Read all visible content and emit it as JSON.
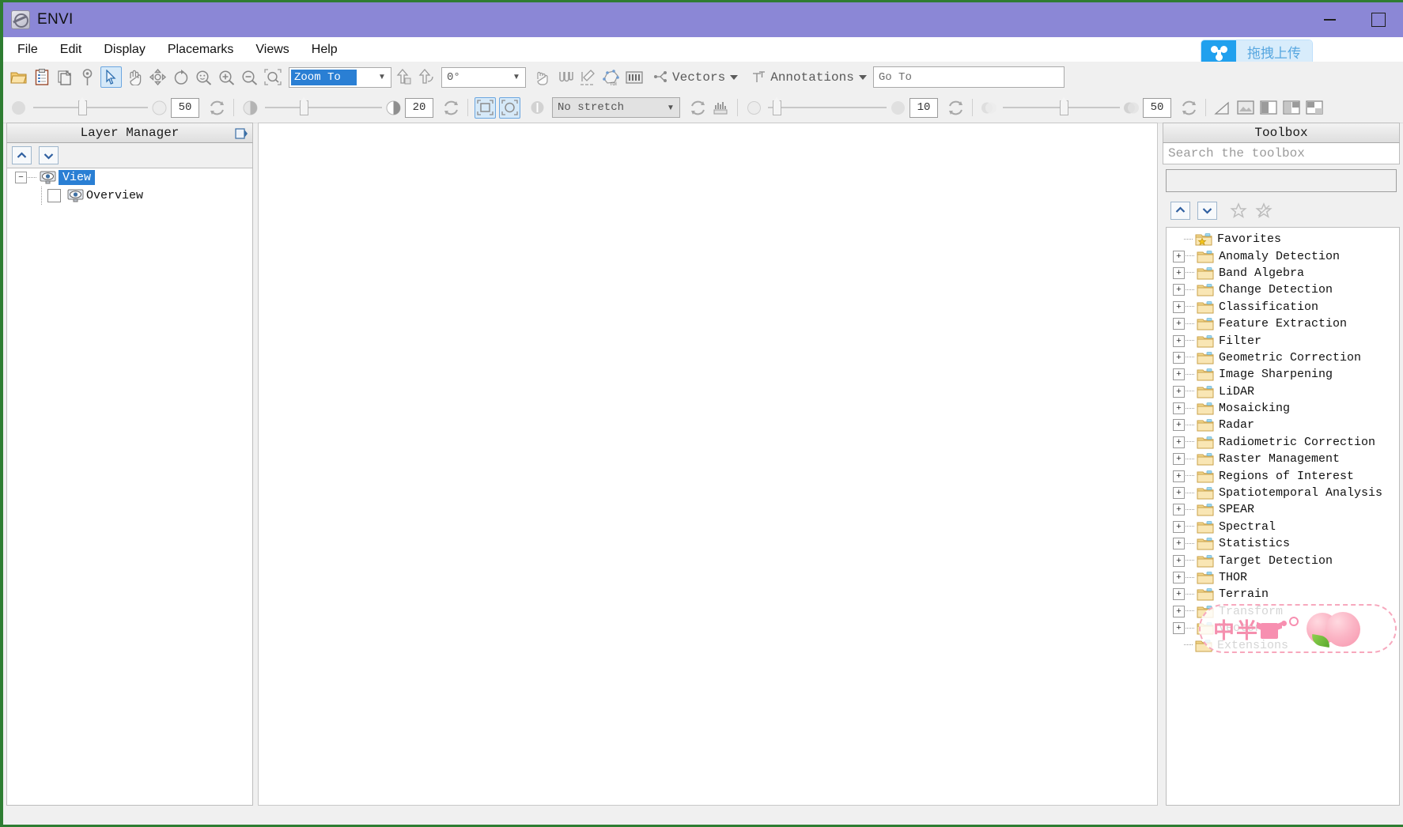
{
  "window": {
    "title": "ENVI",
    "app_icon": "envi-globe-icon",
    "minimize_label": "minimize",
    "maximize_label": "maximize"
  },
  "menu": {
    "items": [
      {
        "label": "File"
      },
      {
        "label": "Edit"
      },
      {
        "label": "Display"
      },
      {
        "label": "Placemarks"
      },
      {
        "label": "Views"
      },
      {
        "label": "Help"
      }
    ],
    "upload_button": {
      "label": "拖拽上传",
      "icon": "cloud-upload-icon",
      "icon_bg": "#20a0ee",
      "label_bg": "#d8ecfb",
      "label_color": "#58a7e0"
    }
  },
  "toolbar_main": {
    "buttons": [
      {
        "name": "open-file-icon",
        "title": "Open"
      },
      {
        "name": "clipboard-icon",
        "title": "Open Recent"
      },
      {
        "name": "save-layers-icon",
        "title": "Save"
      },
      {
        "name": "placemark-pin-icon",
        "title": "Placemark"
      },
      {
        "name": "select-arrow-icon",
        "title": "Select",
        "selected": true
      },
      {
        "name": "pan-hand-icon",
        "title": "Pan"
      },
      {
        "name": "fly-move-icon",
        "title": "Fly"
      },
      {
        "name": "rotate-icon",
        "title": "Rotate"
      },
      {
        "name": "zoom-full-icon",
        "title": "Zoom to Full Extent"
      },
      {
        "name": "zoom-in-icon",
        "title": "Zoom In"
      },
      {
        "name": "zoom-out-icon",
        "title": "Zoom Out"
      },
      {
        "name": "zoom-window-icon",
        "title": "Zoom to Window"
      }
    ],
    "zoom_combo": {
      "value": "Zoom To",
      "selected": true
    },
    "north_buttons": [
      {
        "name": "north-up-icon",
        "title": "North Up"
      },
      {
        "name": "rotate-north-icon",
        "title": "Rotate to North"
      }
    ],
    "angle_combo": {
      "value": "0°"
    },
    "right_buttons": [
      {
        "name": "crosshair-cursor-icon",
        "title": "Cursor Value"
      },
      {
        "name": "spectral-profile-icon",
        "title": "Spectral Profile"
      },
      {
        "name": "transect-icon",
        "title": "Transect"
      },
      {
        "name": "roi-tool-icon",
        "title": "Region of Interest"
      },
      {
        "name": "band-threshold-icon",
        "title": "Band Threshold"
      }
    ],
    "vectors_menu": {
      "label": "Vectors",
      "icon": "vectors-icon"
    },
    "annotations_menu": {
      "label": "Annotations",
      "icon": "annotations-text-icon"
    },
    "goto_combo": {
      "value": "Go To"
    }
  },
  "toolbar_secondary": {
    "brightness": {
      "icon": "brightness-icon",
      "value": "50",
      "reset_icon": "reset-icon",
      "slider_pct": 42
    },
    "contrast": {
      "icon": "contrast-icon",
      "value": "20",
      "reset_icon": "reset-icon",
      "slider_pct": 30
    },
    "portal_buttons": [
      {
        "name": "portal-rect-icon",
        "title": "Portal",
        "selected": true
      },
      {
        "name": "portal-blend-icon",
        "title": "Blend Portal"
      }
    ],
    "stretch_refresh": {
      "name": "stretch-refresh-icon"
    },
    "stretch_combo": {
      "value": "No stretch"
    },
    "stretch_reset": {
      "name": "reset-icon"
    },
    "histogram_button": {
      "name": "histogram-icon"
    },
    "sharpen": {
      "icon": "sharpen-icon",
      "value": "10",
      "reset_icon": "reset-icon",
      "slider_pct": 5
    },
    "transparency": {
      "icon": "transparency-icon",
      "value": "50",
      "reset_icon": "reset-icon",
      "slider_pct": 52
    },
    "end_buttons": [
      {
        "name": "measure-icon",
        "title": "Measure"
      },
      {
        "name": "image-view-icon",
        "title": "Image View"
      },
      {
        "name": "two-panel-view-icon",
        "title": "Two Panel View"
      },
      {
        "name": "three-panel-view-icon",
        "title": "Three Panel View"
      },
      {
        "name": "four-panel-view-icon",
        "title": "Four Panel View"
      }
    ]
  },
  "layer_manager": {
    "title": "Layer Manager",
    "pin_icon": "pin-icon",
    "up_button": "move-up-icon",
    "down_button": "move-down-icon",
    "tree": [
      {
        "label": "View",
        "icon": "view-eye-icon",
        "expander": "−",
        "selected": true,
        "children": [
          {
            "label": "Overview",
            "icon": "view-eye-icon",
            "checkbox": true,
            "checked": false
          }
        ]
      }
    ]
  },
  "toolbox": {
    "title": "Toolbox",
    "search": {
      "placeholder": "Search the toolbox",
      "value": ""
    },
    "filter_box_value": "",
    "up_button": "move-up-icon",
    "down_button": "move-down-icon",
    "add_favorite_button": "star-add-icon",
    "remove_favorite_button": "star-remove-icon",
    "items": [
      {
        "label": "Favorites",
        "icon": "favorites-folder-icon",
        "expandable": false
      },
      {
        "label": "Anomaly Detection",
        "icon": "folder-icon",
        "expandable": true
      },
      {
        "label": "Band Algebra",
        "icon": "folder-icon",
        "expandable": true
      },
      {
        "label": "Change Detection",
        "icon": "folder-icon",
        "expandable": true
      },
      {
        "label": "Classification",
        "icon": "folder-icon",
        "expandable": true
      },
      {
        "label": "Feature Extraction",
        "icon": "folder-icon",
        "expandable": true
      },
      {
        "label": "Filter",
        "icon": "folder-icon",
        "expandable": true
      },
      {
        "label": "Geometric Correction",
        "icon": "folder-icon",
        "expandable": true
      },
      {
        "label": "Image Sharpening",
        "icon": "folder-icon",
        "expandable": true
      },
      {
        "label": "LiDAR",
        "icon": "folder-icon",
        "expandable": true
      },
      {
        "label": "Mosaicking",
        "icon": "folder-icon",
        "expandable": true
      },
      {
        "label": "Radar",
        "icon": "folder-icon",
        "expandable": true
      },
      {
        "label": "Radiometric Correction",
        "icon": "folder-icon",
        "expandable": true
      },
      {
        "label": "Raster Management",
        "icon": "folder-icon",
        "expandable": true
      },
      {
        "label": "Regions of Interest",
        "icon": "folder-icon",
        "expandable": true
      },
      {
        "label": "Spatiotemporal Analysis",
        "icon": "folder-icon",
        "expandable": true
      },
      {
        "label": "SPEAR",
        "icon": "folder-icon",
        "expandable": true
      },
      {
        "label": "Spectral",
        "icon": "folder-icon",
        "expandable": true
      },
      {
        "label": "Statistics",
        "icon": "folder-icon",
        "expandable": true
      },
      {
        "label": "Target Detection",
        "icon": "folder-icon",
        "expandable": true
      },
      {
        "label": "THOR",
        "icon": "folder-icon",
        "expandable": true
      },
      {
        "label": "Terrain",
        "icon": "folder-icon",
        "expandable": true
      },
      {
        "label": "Transform",
        "icon": "folder-icon",
        "expandable": true
      },
      {
        "label": "Vector",
        "icon": "folder-icon",
        "expandable": true
      },
      {
        "label": "Extensions",
        "icon": "folder-icon",
        "expandable": false
      }
    ]
  },
  "watermark": {
    "text": "中半",
    "shirt_icon": "t-shirt-icon",
    "peach_icon": "peach-icon",
    "border_color": "#f7a8bd"
  }
}
